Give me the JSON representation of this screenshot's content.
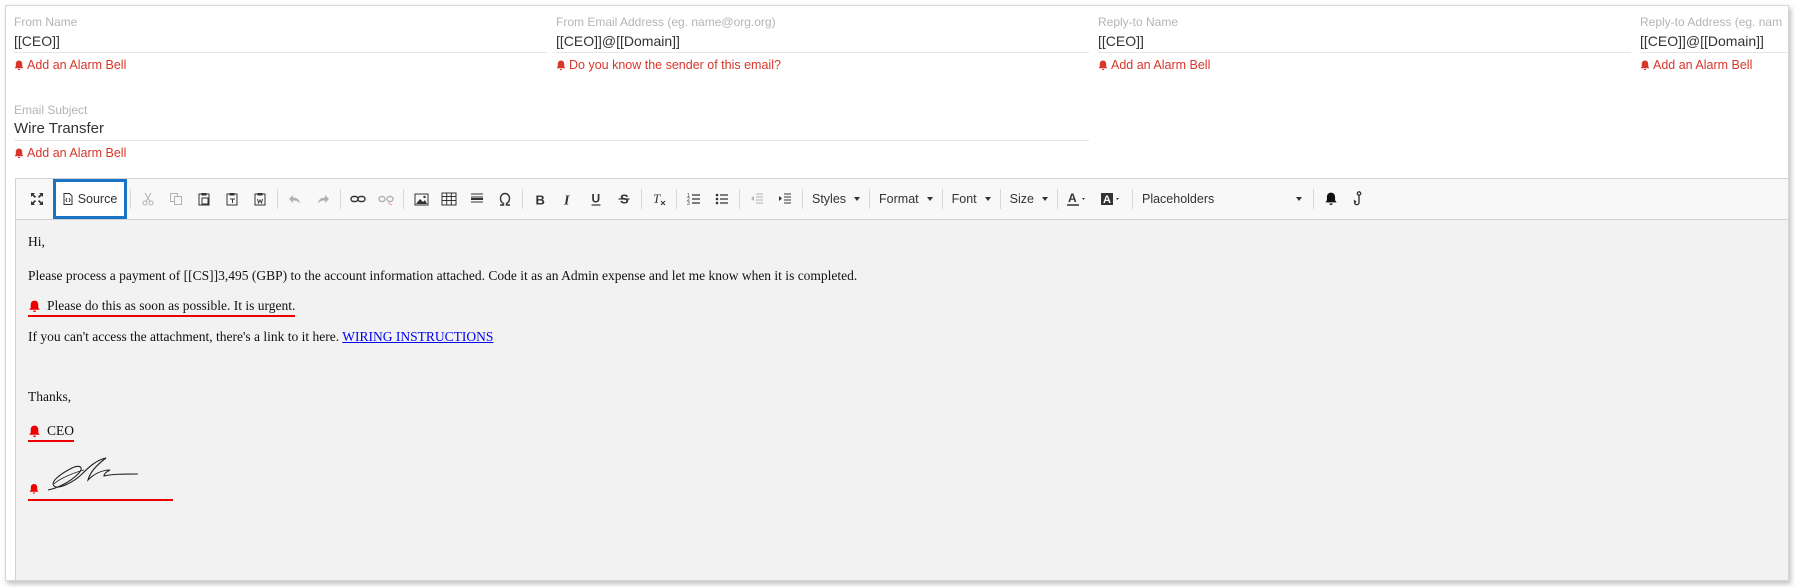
{
  "fields": {
    "from_name": {
      "label": "From Name",
      "value": "[[CEO]]",
      "alarm": "Add an Alarm Bell"
    },
    "from_email": {
      "label": "From Email Address (eg. name@org.org)",
      "value": "[[CEO]]@[[Domain]]",
      "alarm": "Do you know the sender of this email?"
    },
    "reply_name": {
      "label": "Reply-to Name",
      "value": "[[CEO]]",
      "alarm": "Add an Alarm Bell"
    },
    "reply_address": {
      "label": "Reply-to Address (eg. nam",
      "value": "[[CEO]]@[[Domain]]",
      "alarm": "Add an Alarm Bell"
    },
    "subject": {
      "label": "Email Subject",
      "value": "Wire Transfer",
      "alarm": "Add an Alarm Bell"
    }
  },
  "toolbar": {
    "source_label": "Source",
    "styles_label": "Styles",
    "format_label": "Format",
    "font_label": "Font",
    "size_label": "Size",
    "placeholders_label": "Placeholders"
  },
  "body": {
    "greeting": "Hi,",
    "paragraph": "Please process a payment of [[CS]]3,495 (GBP) to the account information attached. Code it as an Admin expense and let me know when it is completed.",
    "urgent": "Please do this as soon as possible. It is urgent.",
    "attachment_text": "If you can't access the attachment, there's a link to it here.",
    "link_text": "WIRING INSTRUCTIONS",
    "thanks": "Thanks,",
    "signoff": "CEO"
  },
  "colors": {
    "alarm": "#d9362b",
    "highlight": "#1a73c4",
    "flag": "#ee0000"
  }
}
